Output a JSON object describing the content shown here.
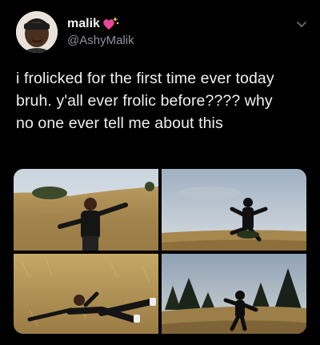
{
  "tweet": {
    "display_name": "malik",
    "handle": "@AshyMalik",
    "text_lines": [
      "i frolicked for the first time ever today",
      "bruh. y'all ever frolic before???? why",
      "no one ever tell me about this"
    ],
    "name_emoji_icon": "sparkling-heart-icon",
    "menu_icon": "chevron-down-icon"
  },
  "media": {
    "photo_count": 4
  },
  "colors": {
    "background": "#000000",
    "handle": "#8e959c",
    "emoji": "#e8469a"
  }
}
